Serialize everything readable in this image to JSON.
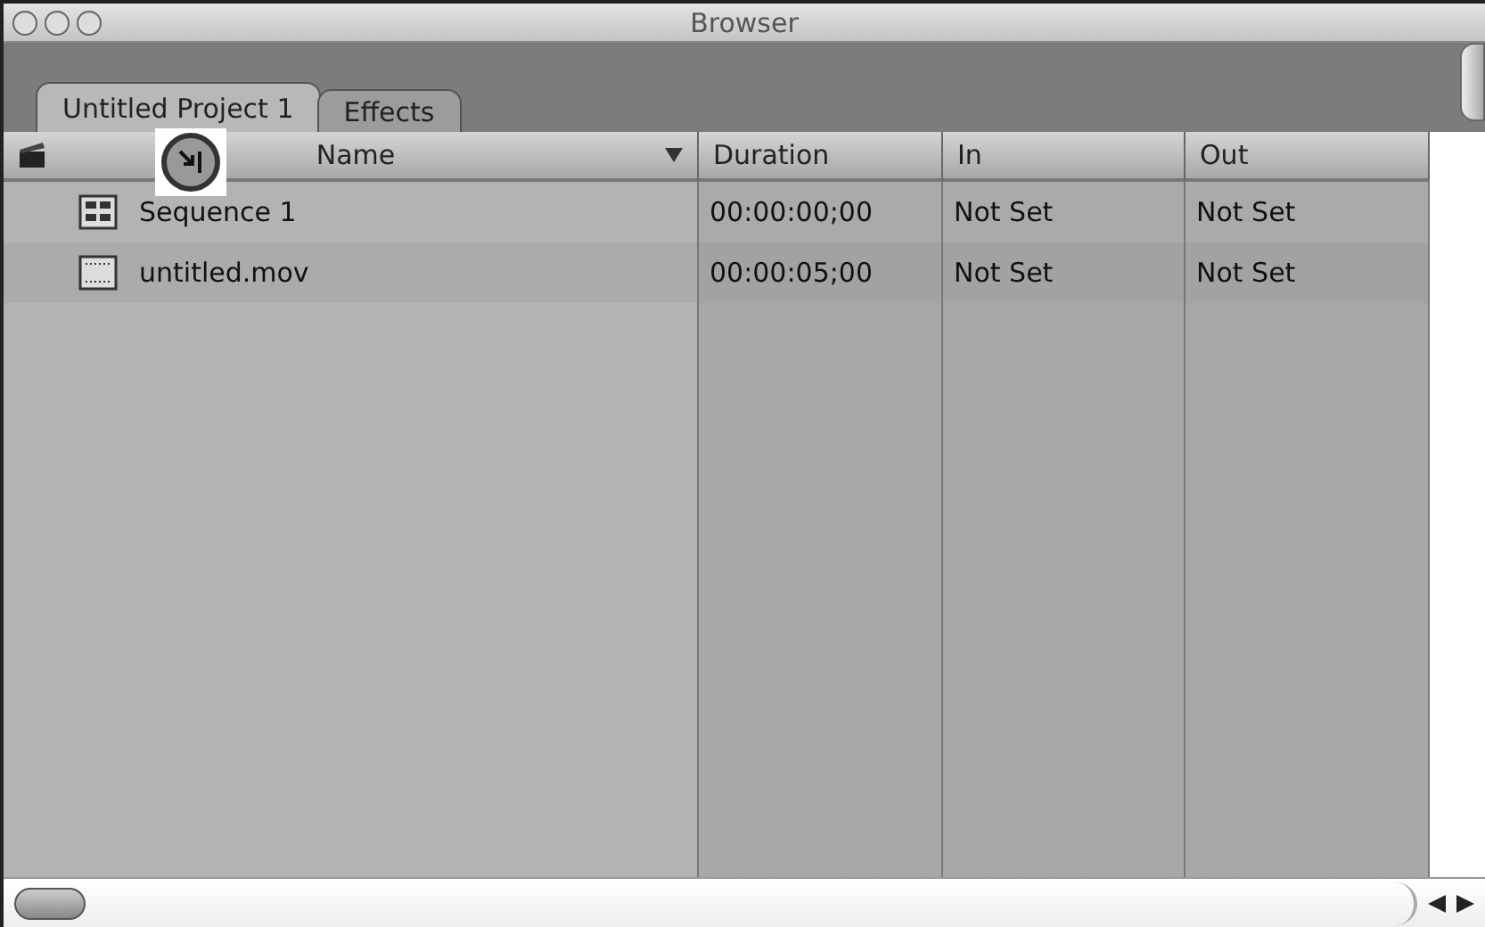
{
  "window": {
    "title": "Browser"
  },
  "tabs": [
    {
      "label": "Untitled Project 1",
      "selected": true
    },
    {
      "label": "Effects",
      "selected": false
    }
  ],
  "table": {
    "columns": [
      "Name",
      "Duration",
      "In",
      "Out"
    ],
    "rows": [
      {
        "kind": "sequence",
        "cells": [
          "Sequence 1",
          "00:00:00;00",
          "Not Set",
          "Not Set"
        ]
      },
      {
        "kind": "clip",
        "cells": [
          "untitled.mov",
          "00:00:05;00",
          "Not Set",
          "Not Set"
        ]
      }
    ]
  }
}
